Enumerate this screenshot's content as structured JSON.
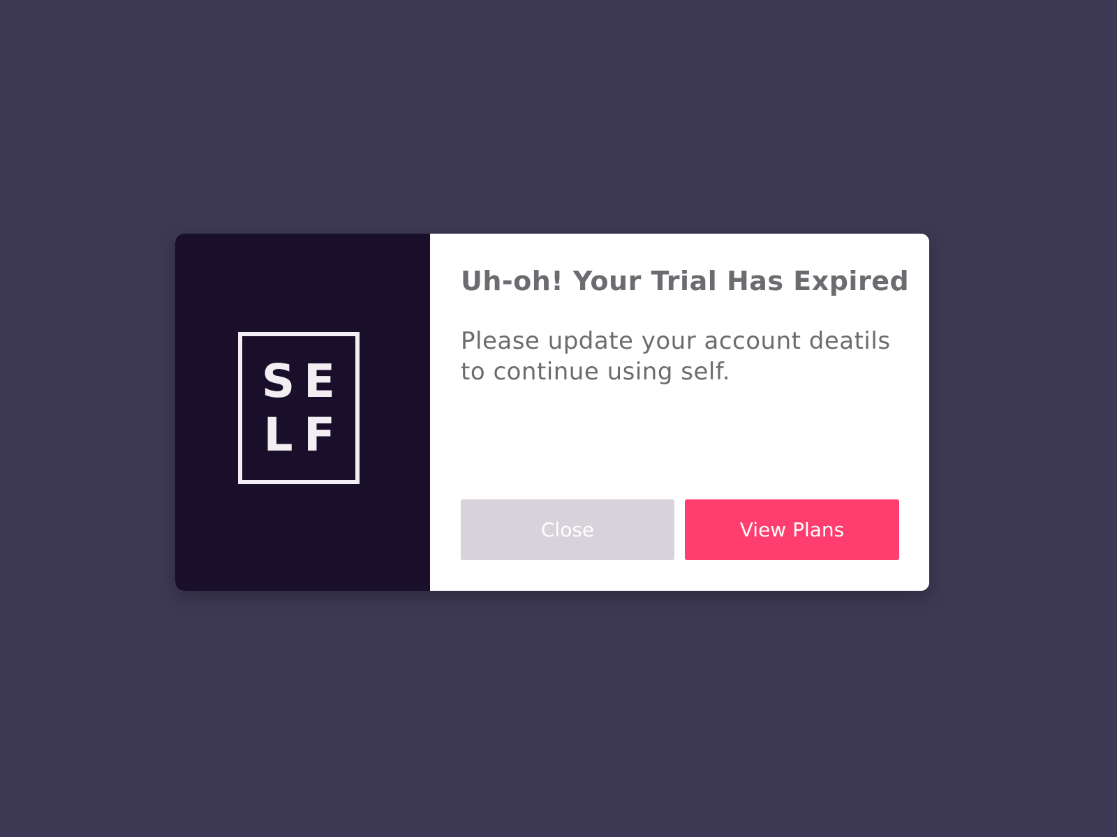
{
  "modal": {
    "logo": {
      "letters": [
        "S",
        "E",
        "L",
        "F"
      ]
    },
    "title": "Uh-oh! Your Trial Has Expired",
    "message": "Please update your account deatils to continue using self.",
    "buttons": {
      "close_label": "Close",
      "view_plans_label": "View Plans"
    }
  },
  "colors": {
    "background": "#3d3955",
    "brand_panel": "#1a0f2a",
    "close_button": "#d8d2da",
    "primary_button": "#ff3d6e",
    "text": "#6e6b70"
  }
}
